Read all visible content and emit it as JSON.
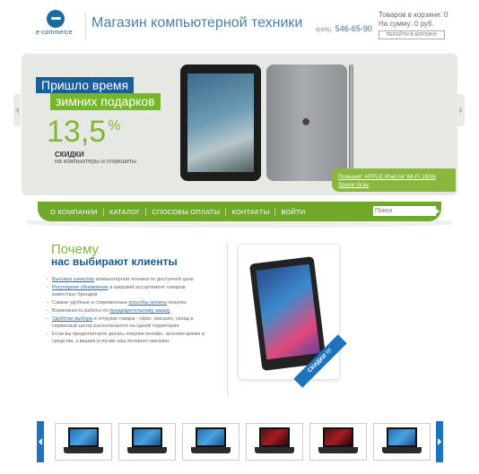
{
  "header": {
    "logo_text": "e-commerce",
    "site_title": "Магазин компьютерной техники",
    "phone_code": "8(495)",
    "phone_number": "546-65-90",
    "cart": {
      "items": "Товаров в корзине: 0",
      "sum": "На сумму: 0 руб.",
      "go_button": "ПЕРЕЙТИ В КОРЗИНУ"
    }
  },
  "banner": {
    "promo_line1": "Пришло время",
    "promo_line2": "зимних подарков",
    "discount_value": "13,5",
    "discount_unit": "%",
    "discount_label": "СКИДКИ",
    "discount_desc": "на компьютеры и планшеты",
    "product_link": "Планшет APPLE iPad Air Wi-Fi 16Gb Space Gray"
  },
  "nav": {
    "items": [
      "О КОМПАНИИ",
      "КАТАЛОГ",
      "СПОСОБЫ ОПЛАТЫ",
      "КОНТАКТЫ",
      "ВОЙТИ"
    ],
    "search_placeholder": "Поиск"
  },
  "why": {
    "title1": "Почему",
    "title2": "нас выбирают клиенты",
    "items": [
      {
        "link": "Высокое качество",
        "text": " компьютерной техники по доступной цене"
      },
      {
        "link": "Регулярное обновление",
        "text": " и широкий ассортимент товаров известных брендов"
      },
      {
        "pre": "Самые удобные и современные ",
        "link": "способы оплаты",
        "text": " покупок"
      },
      {
        "pre": "Возможность работы по ",
        "link": "предварительному заказу",
        "text": ""
      },
      {
        "link": "Удобство выбора",
        "text": " и отгрузки товара - офис, магазин, склад и сервисный центр располагаются на одной территории"
      },
      {
        "pre": "Если вы предпочитаете делать покупки онлайн, экономя время и средства, к вашим услугам наш интернет-магазин.",
        "link": "",
        "text": ""
      }
    ]
  },
  "promo": {
    "ribbon": "СКИДКИ !!!"
  },
  "carousel": {
    "thumbs": [
      "laptop-1",
      "laptop-2",
      "laptop-3",
      "laptop-4",
      "laptop-5",
      "laptop-6"
    ]
  },
  "colors": {
    "brand_blue": "#1a5f9a",
    "brand_green": "#76b72a",
    "nav_green": "#6fa82a"
  }
}
